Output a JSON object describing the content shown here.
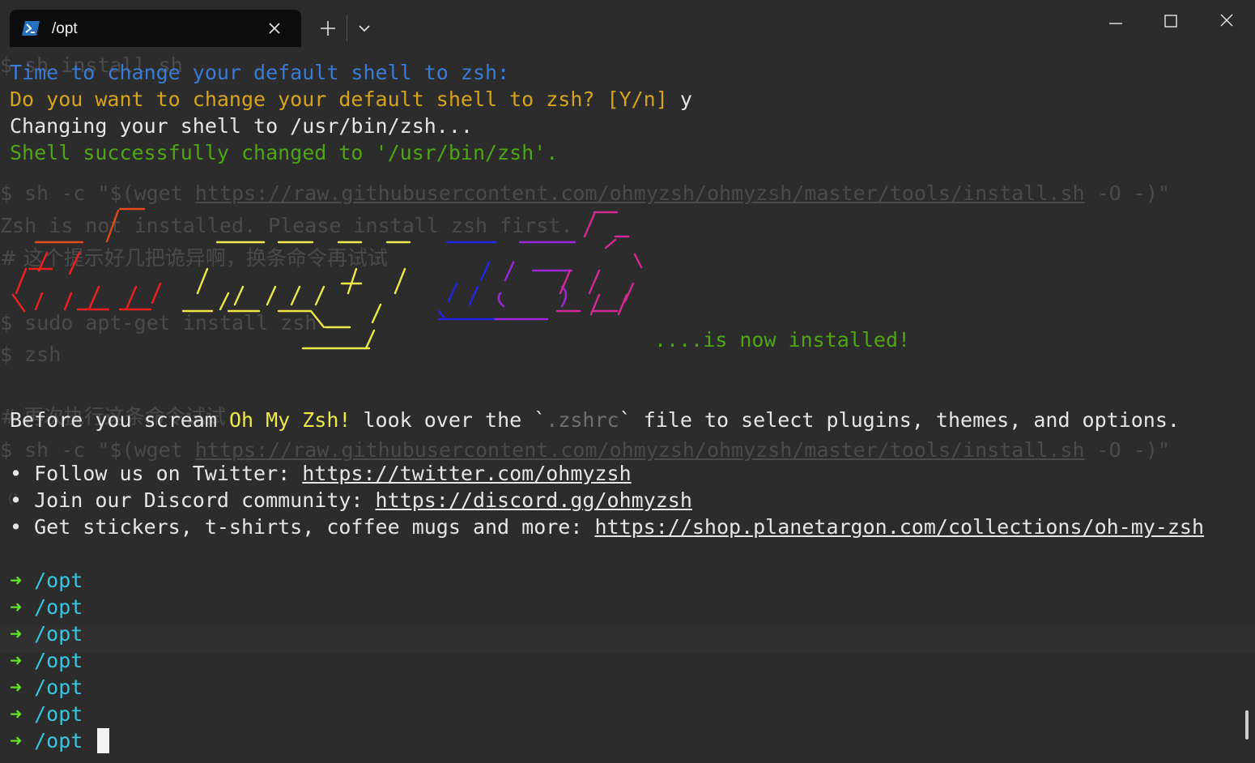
{
  "window": {
    "tab_title": "/opt",
    "icons": {
      "tab": "powershell-icon",
      "close_tab": "close-icon",
      "new_tab": "plus-icon",
      "dropdown": "chevron-down-icon",
      "minimize": "minimize-icon",
      "maximize": "maximize-icon",
      "close_window": "close-icon"
    }
  },
  "terminal": {
    "ghost": {
      "l1": "$ sh install.sh",
      "l2": "$ sh -c \"$(wget ",
      "l2_url": "https://raw.githubusercontent.com/ohmyzsh/ohmyzsh/master/tools/install.sh",
      "l2_end": " -O -)\"",
      "l3": "Zsh is not installed. Please install zsh first.",
      "l4": "# 这个提示好几把诡异啊，换条命令再试试",
      "l5": "$ sudo apt-get install zsh",
      "l6": "$ zsh",
      "l7": "# 再次执行这条命令试试",
      "l8": "$ sh -c \"$(wget ",
      "l8_url": "https://raw.githubusercontent.com/ohmyzsh/ohmyzsh/master/tools/install.sh",
      "l8_end": " -O -)\"",
      "l9": "（`"
    },
    "time_to_change": "Time to change your default shell to zsh:",
    "prompt_question": "Do you want to change your default shell to zsh? [Y/n]",
    "prompt_answer": " y",
    "changing": "Changing your shell to /usr/bin/zsh...",
    "changed": "Shell successfully changed to '/usr/bin/zsh'.",
    "installed": "....is now installed!",
    "before": {
      "t1": "Before you scream ",
      "t2": "Oh My Zsh!",
      "t3": " look over the `",
      "t4": ".zshrc",
      "t5": "` file to select plugins, themes, and options."
    },
    "links": [
      {
        "prefix": "• Follow us on Twitter: ",
        "url": "https://twitter.com/ohmyzsh"
      },
      {
        "prefix": "• Join our Discord community: ",
        "url": "https://discord.gg/ohmyzsh"
      },
      {
        "prefix": "• Get stickers, t-shirts, coffee mugs and more: ",
        "url": "https://shop.planetargon.com/collections/oh-my-zsh"
      }
    ],
    "prompt_arrow": "➜",
    "prompt_dir": "/opt",
    "colors": {
      "logo": [
        "#e14b1b",
        "#f02020",
        "#ece84a",
        "#2424e6",
        "#9b27d9",
        "#d22b95"
      ]
    }
  }
}
